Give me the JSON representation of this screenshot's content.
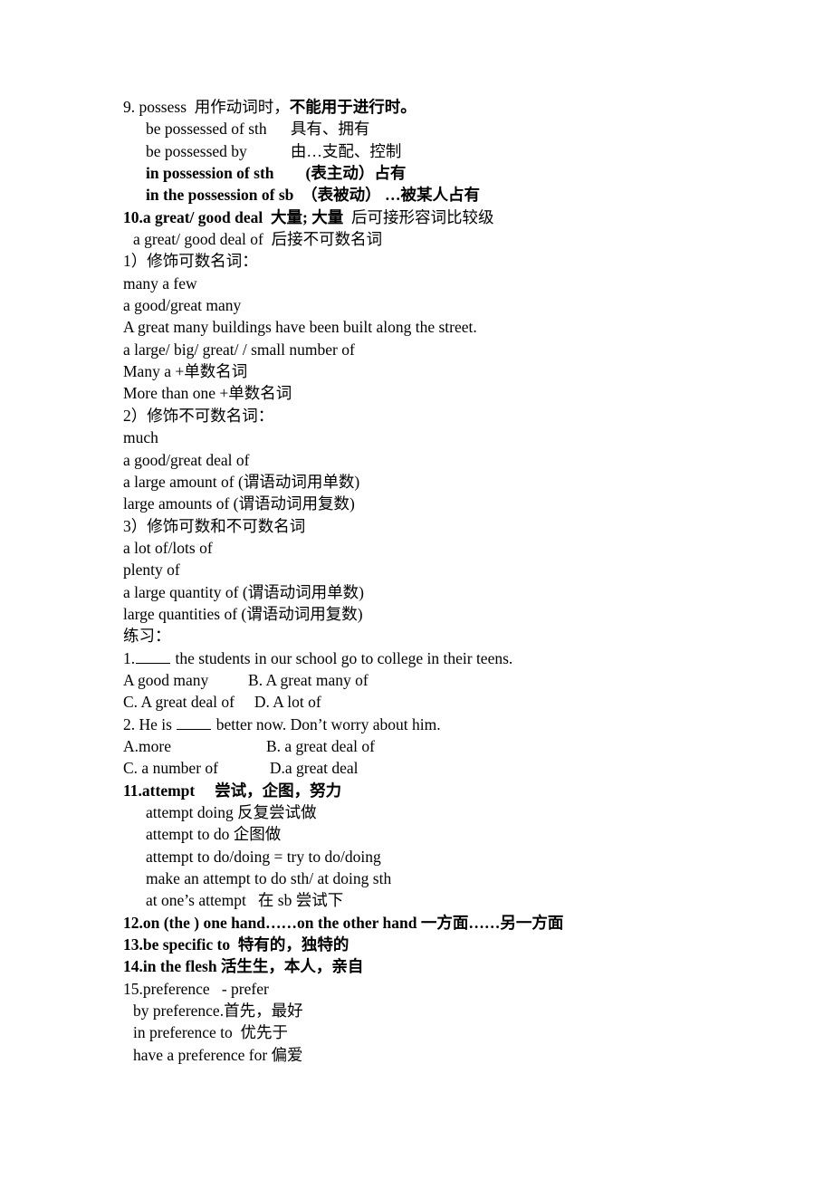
{
  "document": {
    "background_color": "#ffffff",
    "text_color": "#000000",
    "entries": [
      {
        "id": "entry-9",
        "lines": [
          {
            "indent": 0,
            "segments": [
              {
                "text": "9. possess  用作动词时，",
                "bold": false
              },
              {
                "text": "不能用于进行时。",
                "bold": true
              }
            ]
          },
          {
            "indent": 2,
            "segments": [
              {
                "text": "be possessed of sth      具有、拥有",
                "bold": false
              }
            ]
          },
          {
            "indent": 2,
            "segments": [
              {
                "text": "be possessed by           由…支配、控制",
                "bold": false
              }
            ]
          },
          {
            "indent": 2,
            "segments": [
              {
                "text": "in possession of sth        (表主动）占有",
                "bold": true
              }
            ]
          },
          {
            "indent": 2,
            "segments": [
              {
                "text": "in the possession of sb  （表被动） …被某人占有",
                "bold": true
              }
            ]
          }
        ]
      },
      {
        "id": "entry-10",
        "lines": [
          {
            "indent": 0,
            "segments": [
              {
                "text": "10.a great/ good deal  大量; 大量",
                "bold": true
              },
              {
                "text": "  后可接形容词比较级",
                "bold": false
              }
            ]
          },
          {
            "indent": 1,
            "segments": [
              {
                "text": "a great/ good deal of  后接不可数名词",
                "bold": false
              }
            ]
          },
          {
            "indent": 0,
            "segments": [
              {
                "text": "1）修饰可数名词：",
                "bold": false
              }
            ]
          },
          {
            "indent": 0,
            "segments": [
              {
                "text": "many a few",
                "bold": false
              }
            ]
          },
          {
            "indent": 0,
            "segments": [
              {
                "text": "a good/great many",
                "bold": false
              }
            ]
          },
          {
            "indent": 0,
            "segments": [
              {
                "text": "A great many buildings have been built along the street.",
                "bold": false
              }
            ]
          },
          {
            "indent": 0,
            "segments": [
              {
                "text": "a large/ big/ great/ / small number of",
                "bold": false
              }
            ]
          },
          {
            "indent": 0,
            "segments": [
              {
                "text": "Many a +单数名词",
                "bold": false
              }
            ]
          },
          {
            "indent": 0,
            "segments": [
              {
                "text": "More than one +单数名词",
                "bold": false
              }
            ]
          },
          {
            "indent": 0,
            "segments": [
              {
                "text": "2）修饰不可数名词：",
                "bold": false
              }
            ]
          },
          {
            "indent": 0,
            "segments": [
              {
                "text": "much",
                "bold": false
              }
            ]
          },
          {
            "indent": 0,
            "segments": [
              {
                "text": "a good/great deal of",
                "bold": false
              }
            ]
          },
          {
            "indent": 0,
            "segments": [
              {
                "text": "a large amount of (谓语动词用单数)",
                "bold": false
              }
            ]
          },
          {
            "indent": 0,
            "segments": [
              {
                "text": "large amounts of (谓语动词用复数)",
                "bold": false
              }
            ]
          },
          {
            "indent": 0,
            "segments": [
              {
                "text": "3）修饰可数和不可数名词",
                "bold": false
              }
            ]
          },
          {
            "indent": 0,
            "segments": [
              {
                "text": "a lot of/lots of",
                "bold": false
              }
            ]
          },
          {
            "indent": 0,
            "segments": [
              {
                "text": "plenty of",
                "bold": false
              }
            ]
          },
          {
            "indent": 0,
            "segments": [
              {
                "text": "a large quantity of (谓语动词用单数)",
                "bold": false
              }
            ]
          },
          {
            "indent": 0,
            "segments": [
              {
                "text": "large quantities of (谓语动词用复数)",
                "bold": false
              }
            ]
          }
        ]
      },
      {
        "id": "exercises",
        "heading": "练习：",
        "lines": [
          {
            "indent": 0,
            "segments": [
              {
                "text": "练习：",
                "bold": false
              }
            ]
          },
          {
            "indent": 0,
            "blank_after": "1.",
            "segments": [
              {
                "text": "1.",
                "bold": false
              },
              {
                "blank": true
              },
              {
                "text": " the students in our school go to college in their teens.",
                "bold": false
              }
            ]
          },
          {
            "indent": 0,
            "segments": [
              {
                "text": "A good many          B. A great many of",
                "bold": false
              }
            ]
          },
          {
            "indent": 0,
            "segments": [
              {
                "text": "C. A great deal of     D. A lot of",
                "bold": false
              }
            ]
          },
          {
            "indent": 0,
            "segments": [
              {
                "text": "2. He is ",
                "bold": false
              },
              {
                "blank": true
              },
              {
                "text": " better now. Don’t worry about him.",
                "bold": false
              }
            ]
          },
          {
            "indent": 0,
            "segments": [
              {
                "text": "A.more                        B. a great deal of",
                "bold": false
              }
            ]
          },
          {
            "indent": 0,
            "segments": [
              {
                "text": "C. a number of             D.a great deal",
                "bold": false
              }
            ]
          }
        ]
      },
      {
        "id": "entry-11",
        "lines": [
          {
            "indent": 0,
            "segments": [
              {
                "text": "11.attempt     尝试，企图，努力",
                "bold": true
              }
            ]
          },
          {
            "indent": 2,
            "segments": [
              {
                "text": "attempt doing 反复尝试做",
                "bold": false
              }
            ]
          },
          {
            "indent": 2,
            "segments": [
              {
                "text": "attempt to do 企图做",
                "bold": false
              }
            ]
          },
          {
            "indent": 2,
            "segments": [
              {
                "text": "attempt to do/doing = try to do/doing",
                "bold": false
              }
            ]
          },
          {
            "indent": 2,
            "segments": [
              {
                "text": "make an attempt to do sth/ at doing sth",
                "bold": false
              }
            ]
          },
          {
            "indent": 2,
            "segments": [
              {
                "text": "at one’s attempt   在 sb 尝试下",
                "bold": false
              }
            ]
          }
        ]
      },
      {
        "id": "entry-12",
        "lines": [
          {
            "indent": 0,
            "segments": [
              {
                "text": "12.on (the ) one hand……on the other hand 一方面……另一方面",
                "bold": true
              }
            ]
          }
        ]
      },
      {
        "id": "entry-13",
        "lines": [
          {
            "indent": 0,
            "segments": [
              {
                "text": "13.be specific to  特有的，独特的",
                "bold": true
              }
            ]
          }
        ]
      },
      {
        "id": "entry-14",
        "lines": [
          {
            "indent": 0,
            "segments": [
              {
                "text": "14.in the flesh 活生生，本人，亲自",
                "bold": true
              }
            ]
          }
        ]
      },
      {
        "id": "entry-15",
        "lines": [
          {
            "indent": 0,
            "segments": [
              {
                "text": "15.preference   - prefer",
                "bold": false
              }
            ]
          },
          {
            "indent": 1,
            "segments": [
              {
                "text": "by preference.首先，最好",
                "bold": false
              }
            ]
          },
          {
            "indent": 1,
            "segments": [
              {
                "text": "in preference to  优先于",
                "bold": false
              }
            ]
          },
          {
            "indent": 1,
            "segments": [
              {
                "text": "have a preference for 偏爱",
                "bold": false
              }
            ]
          }
        ]
      }
    ]
  }
}
